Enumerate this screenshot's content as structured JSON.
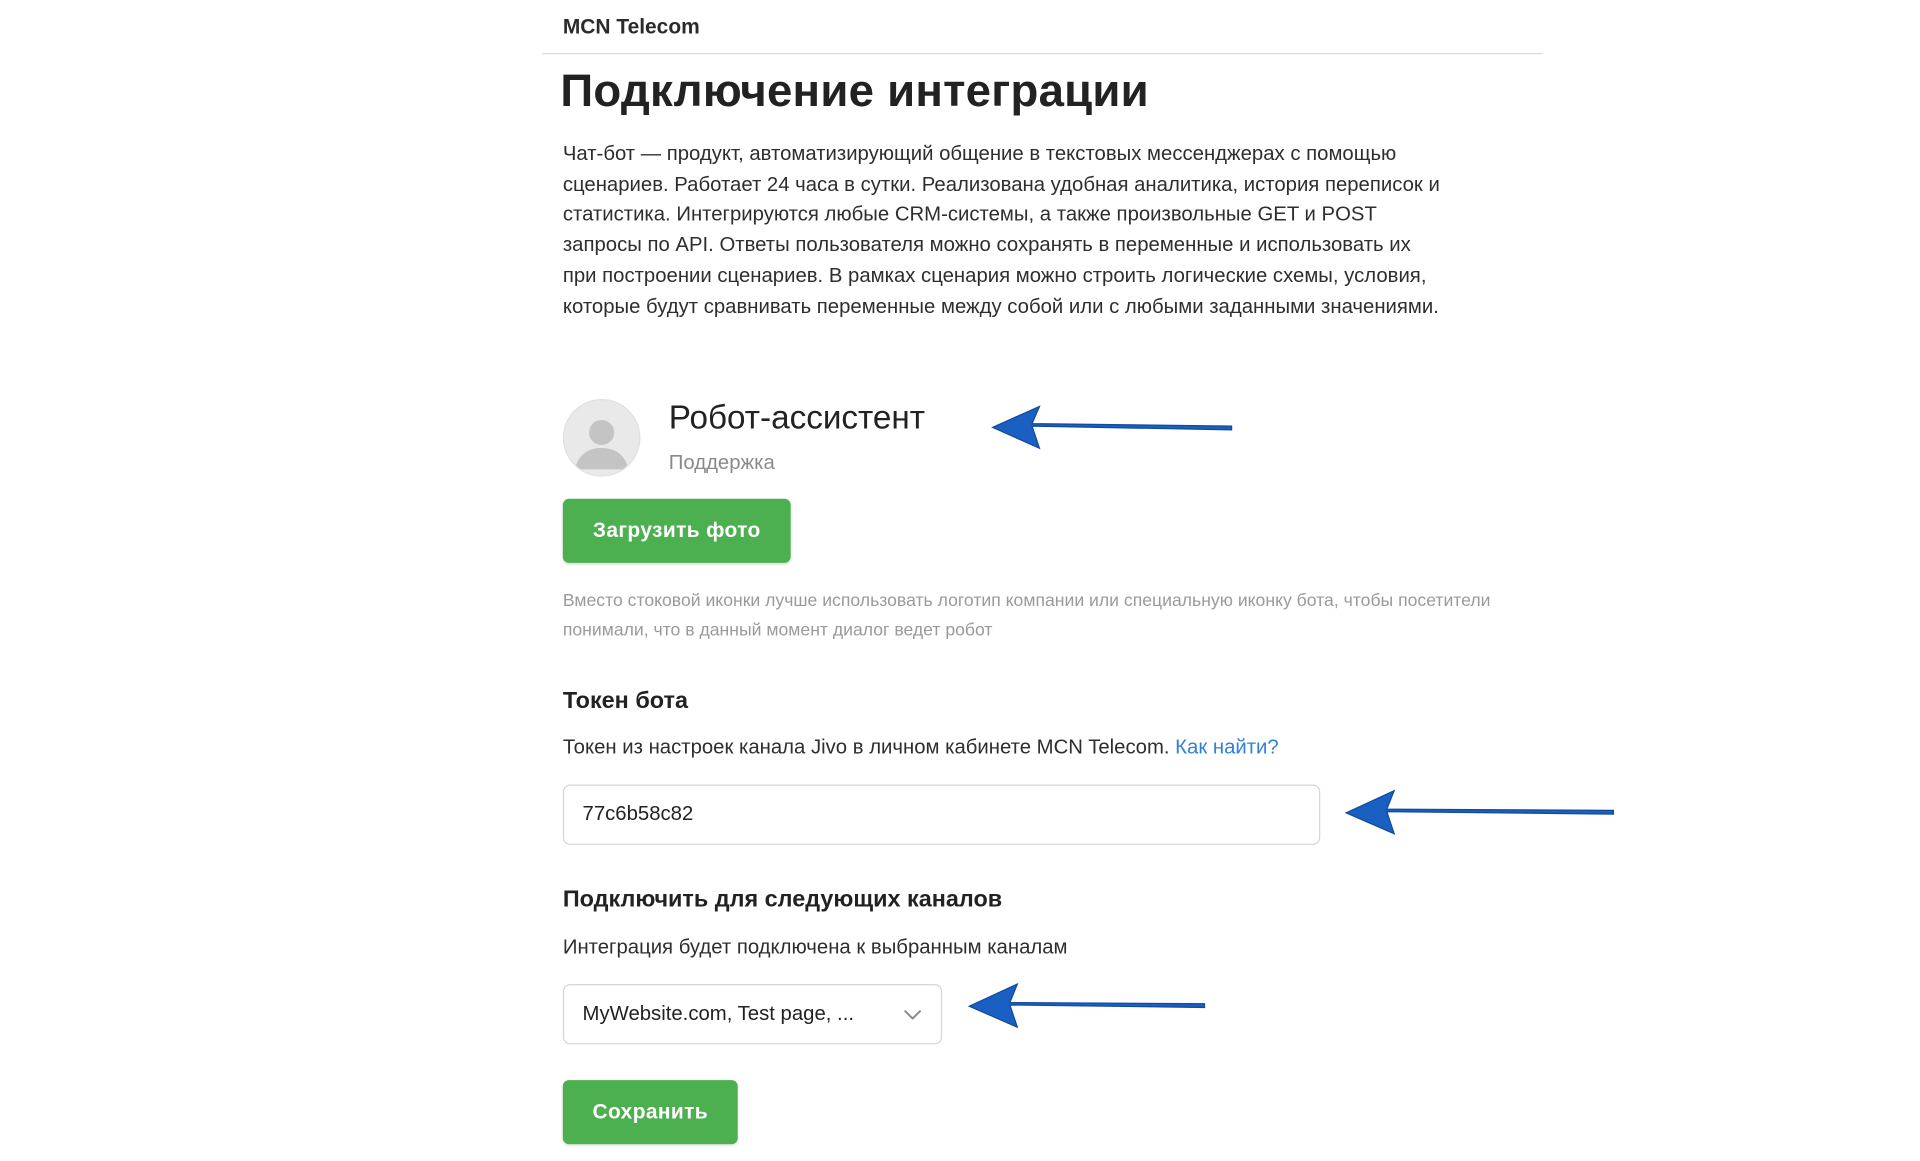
{
  "header": {
    "title": "MCN Telecom"
  },
  "page": {
    "title": "Подключение интеграции",
    "description": "Чат-бот — продукт, автоматизирующий общение в текстовых мессенджерах с помощью сценариев. Работает 24 часа в сутки. Реализована удобная аналитика, история переписок и статистика. Интегрируются любые CRM-системы, а также произвольные GET и POST запросы по API. Ответы пользователя можно сохранять в переменные и использовать их при построении сценариев. В рамках сценария можно строить логические схемы, условия, которые будут сравнивать переменные между собой или с любыми заданными значениями."
  },
  "bot": {
    "avatar_icon": "user-placeholder-icon",
    "name": "Робот-ассистент",
    "role": "Поддержка",
    "upload_label": "Загрузить фото",
    "hint": "Вместо стоковой иконки лучше использовать логотип компании или специальную иконку бота, чтобы посетители понимали, что в данный момент диалог ведет робот"
  },
  "token": {
    "title": "Токен бота",
    "description": "Токен из настроек канала Jivo в личном кабинете MCN Telecom.",
    "help_link": "Как найти?",
    "value": "77c6b58c82"
  },
  "channels": {
    "title": "Подключить для следующих каналов",
    "description": "Интеграция будет подключена к выбранным каналам",
    "selected": "MyWebsite.com, Test page, ...",
    "dropdown_icon": "chevron-down-icon"
  },
  "actions": {
    "save_label": "Сохранить"
  },
  "colors": {
    "accent_green": "#4caf50",
    "link_blue": "#2f80d8",
    "annotation_arrow": "#1a5fc2"
  }
}
